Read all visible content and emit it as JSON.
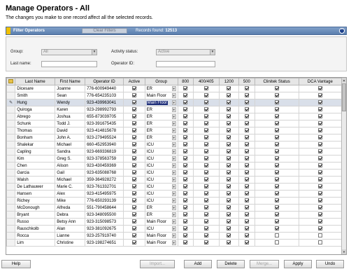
{
  "page": {
    "title": "Manage Operators - All",
    "subtitle": "The changes you make to one record affect all the selected records."
  },
  "filterbar": {
    "label": "Filter Operators",
    "clear_label": "Clear Filters",
    "found_label": "Records found:",
    "found_count": "12513",
    "collapse_icon": "collapse-icon"
  },
  "filters": {
    "group_label": "Group:",
    "group_value": "All",
    "activity_label": "Activity status:",
    "activity_value": "Active",
    "lastname_label": "Last name:",
    "lastname_value": "",
    "operatorid_label": "Operator ID:",
    "operatorid_value": ""
  },
  "grid": {
    "columns": [
      "Last Name",
      "First Name",
      "Operator ID",
      "Active",
      "Group",
      "800",
      "400/405",
      "1200",
      "500",
      "Clinitek Status",
      "DCA Vantage"
    ],
    "rows": [
      {
        "last": "Dicesare",
        "first": "Joanne",
        "id": "776-600949440",
        "active": true,
        "group": "ER",
        "c800": true,
        "c400": true,
        "c1200": true,
        "c500": true,
        "clin": true,
        "dca": true
      },
      {
        "last": "Smith",
        "first": "Sean",
        "id": "776-654235103",
        "active": true,
        "group": "Main Floor",
        "c800": true,
        "c400": true,
        "c1200": true,
        "c500": true,
        "clin": true,
        "dca": true
      },
      {
        "last": "Hung",
        "first": "Wendy",
        "id": "923-439963041",
        "active": true,
        "group": "Main Floor",
        "c800": true,
        "c400": true,
        "c1200": true,
        "c500": true,
        "clin": true,
        "dca": true,
        "editing": true
      },
      {
        "last": "Quiroga",
        "first": "Karen",
        "id": "923-298992793",
        "active": true,
        "group": "ER",
        "c800": true,
        "c400": true,
        "c1200": true,
        "c500": true,
        "clin": true,
        "dca": true
      },
      {
        "last": "Abrego",
        "first": "Joshua",
        "id": "655-873039705",
        "active": true,
        "group": "ER",
        "c800": true,
        "c400": true,
        "c1200": true,
        "c500": true,
        "clin": true,
        "dca": true
      },
      {
        "last": "Schunk",
        "first": "Todd J.",
        "id": "923-391675435",
        "active": true,
        "group": "ER",
        "c800": true,
        "c400": true,
        "c1200": true,
        "c500": true,
        "clin": true,
        "dca": true
      },
      {
        "last": "Thomas",
        "first": "David",
        "id": "923-414815678",
        "active": true,
        "group": "ER",
        "c800": true,
        "c400": true,
        "c1200": true,
        "c500": true,
        "clin": true,
        "dca": true
      },
      {
        "last": "Bonham",
        "first": "John A.",
        "id": "923-279495524",
        "active": true,
        "group": "ER",
        "c800": true,
        "c400": true,
        "c1200": true,
        "c500": true,
        "clin": true,
        "dca": true
      },
      {
        "last": "Shalekar",
        "first": "Michael",
        "id": "660-452953940",
        "active": true,
        "group": "ICU",
        "c800": true,
        "c400": true,
        "c1200": true,
        "c500": true,
        "clin": true,
        "dca": true
      },
      {
        "last": "Capling",
        "first": "Sandra",
        "id": "923-669336819",
        "active": true,
        "group": "ICU",
        "c800": true,
        "c400": true,
        "c1200": true,
        "c500": true,
        "clin": true,
        "dca": true
      },
      {
        "last": "Kim",
        "first": "Greg S.",
        "id": "923-378563759",
        "active": true,
        "group": "ICU",
        "c800": true,
        "c400": true,
        "c1200": true,
        "c500": true,
        "clin": true,
        "dca": true
      },
      {
        "last": "Chen",
        "first": "Alison",
        "id": "923-430459369",
        "active": true,
        "group": "ICU",
        "c800": true,
        "c400": true,
        "c1200": true,
        "c500": true,
        "clin": true,
        "dca": true
      },
      {
        "last": "Garcia",
        "first": "Gail",
        "id": "923-635088768",
        "active": true,
        "group": "ICU",
        "c800": true,
        "c400": true,
        "c1200": true,
        "c500": true,
        "clin": true,
        "dca": true
      },
      {
        "last": "Walsh",
        "first": "Michael",
        "id": "359-364928272",
        "active": true,
        "group": "ICU",
        "c800": true,
        "c400": true,
        "c1200": true,
        "c500": true,
        "clin": true,
        "dca": true
      },
      {
        "last": "De Lathauwer",
        "first": "Marie C.",
        "id": "923-761332701",
        "active": true,
        "group": "ICU",
        "c800": true,
        "c400": true,
        "c1200": true,
        "c500": true,
        "clin": true,
        "dca": true
      },
      {
        "last": "Hansen",
        "first": "Alex",
        "id": "923-415495975",
        "active": true,
        "group": "ICU",
        "c800": true,
        "c400": true,
        "c1200": true,
        "c500": true,
        "clin": true,
        "dca": true
      },
      {
        "last": "Richey",
        "first": "Mike",
        "id": "776-650293139",
        "active": true,
        "group": "ICU",
        "c800": true,
        "c400": true,
        "c1200": true,
        "c500": true,
        "clin": true,
        "dca": true
      },
      {
        "last": "McDonough",
        "first": "Alfreda",
        "id": "551-790458644",
        "active": true,
        "group": "ER",
        "c800": true,
        "c400": true,
        "c1200": true,
        "c500": true,
        "clin": true,
        "dca": true
      },
      {
        "last": "Bryant",
        "first": "Debra",
        "id": "923-348095500",
        "active": true,
        "group": "ER",
        "c800": true,
        "c400": true,
        "c1200": true,
        "c500": true,
        "clin": true,
        "dca": true
      },
      {
        "last": "Russo",
        "first": "Betsy Ann",
        "id": "923-315098573",
        "active": true,
        "group": "Main Floor",
        "c800": true,
        "c400": true,
        "c1200": true,
        "c500": true,
        "clin": true,
        "dca": true
      },
      {
        "last": "Rauschkolb",
        "first": "Alan",
        "id": "923-381092675",
        "active": true,
        "group": "ICU",
        "c800": true,
        "c400": true,
        "c1200": true,
        "c500": true,
        "clin": true,
        "dca": true
      },
      {
        "last": "Rocca",
        "first": "Lianne",
        "id": "923-257919740",
        "active": true,
        "group": "Main Floor",
        "c800": true,
        "c400": true,
        "c1200": true,
        "c500": true,
        "clin": false,
        "dca": false
      },
      {
        "last": "Lim",
        "first": "Christine",
        "id": "923-198274651",
        "active": true,
        "group": "Main Floor",
        "c800": true,
        "c400": true,
        "c1200": true,
        "c500": true,
        "clin": false,
        "dca": false
      }
    ]
  },
  "buttons": {
    "help": "Help",
    "import": "Import...",
    "add": "Add",
    "delete": "Delete",
    "merge": "Merge...",
    "apply": "Apply",
    "undo": "Undo"
  }
}
